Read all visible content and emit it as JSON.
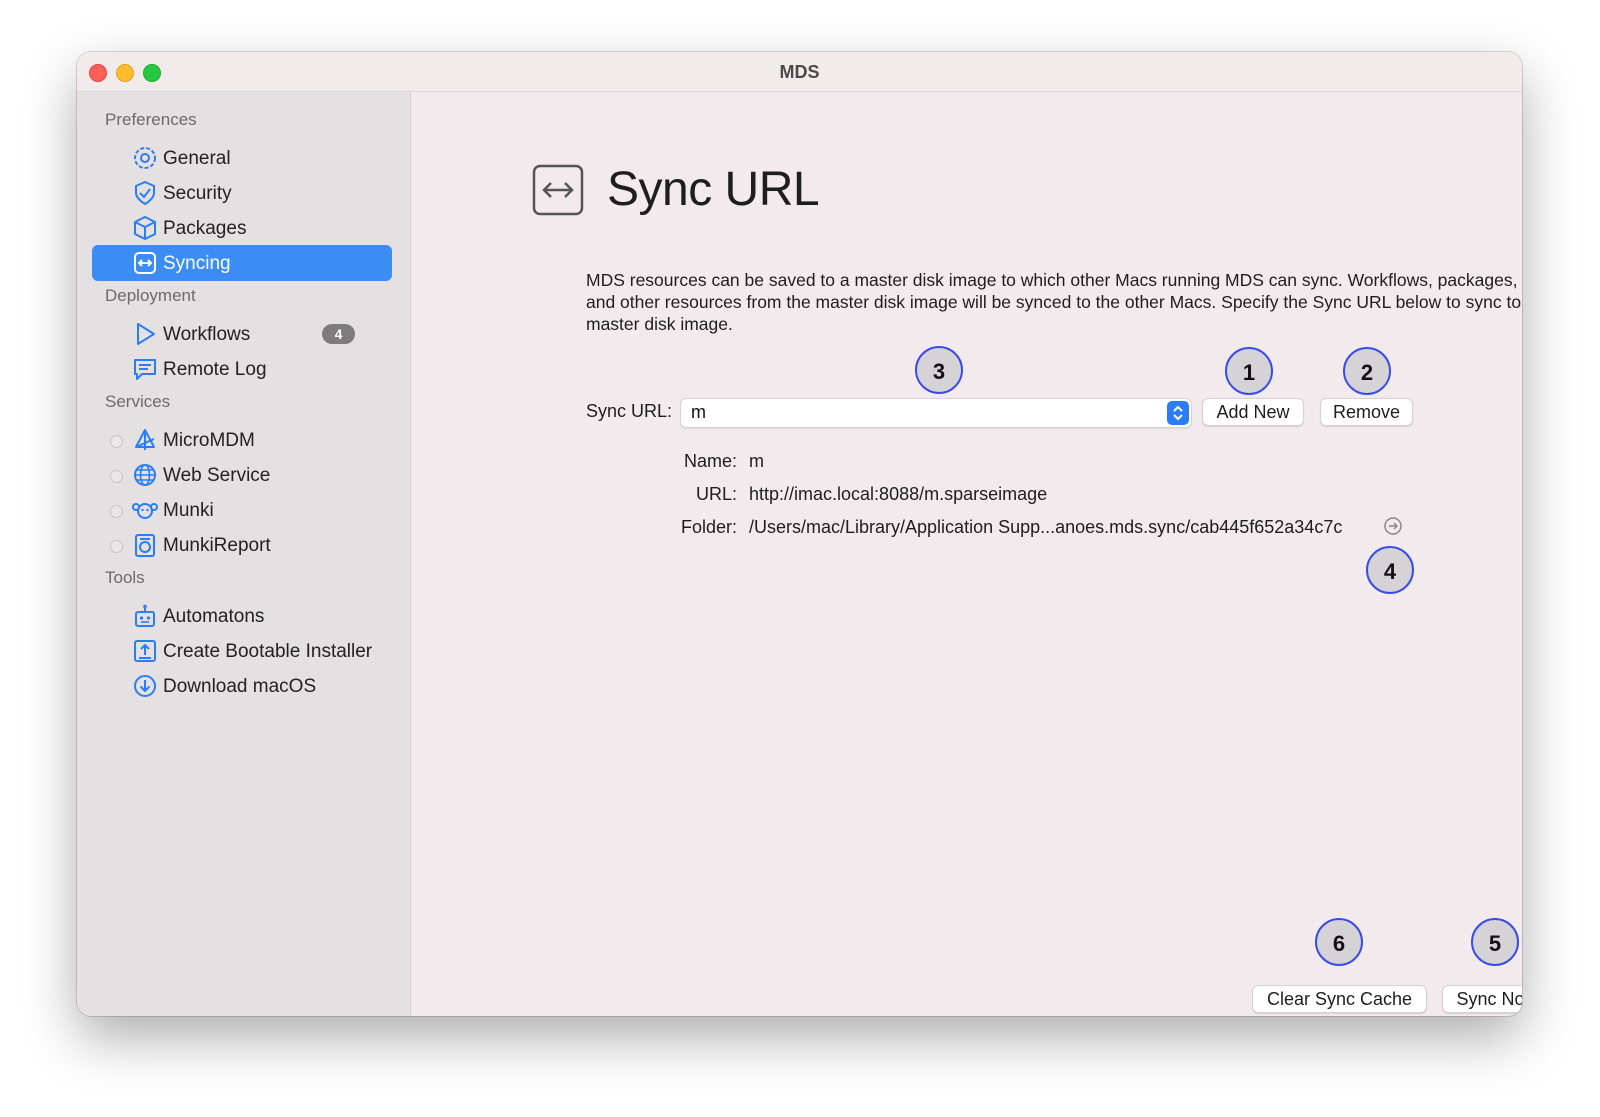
{
  "window": {
    "title": "MDS"
  },
  "sidebar": {
    "sections": [
      {
        "label": "Preferences"
      },
      {
        "label": "Deployment"
      },
      {
        "label": "Services"
      },
      {
        "label": "Tools"
      }
    ],
    "items": [
      {
        "label": "General",
        "icon": "gear-icon"
      },
      {
        "label": "Security",
        "icon": "shield-check-icon"
      },
      {
        "label": "Packages",
        "icon": "package-icon"
      },
      {
        "label": "Syncing",
        "icon": "sync-arrows-icon",
        "selected": true
      },
      {
        "label": "Workflows",
        "icon": "play-icon",
        "badge": "4"
      },
      {
        "label": "Remote Log",
        "icon": "message-log-icon"
      },
      {
        "label": "MicroMDM",
        "icon": "micromdm-icon"
      },
      {
        "label": "Web Service",
        "icon": "globe-icon"
      },
      {
        "label": "Munki",
        "icon": "munki-icon"
      },
      {
        "label": "MunkiReport",
        "icon": "munkireport-icon"
      },
      {
        "label": "Automatons",
        "icon": "robot-icon"
      },
      {
        "label": "Create Bootable Installer",
        "icon": "upload-drive-icon"
      },
      {
        "label": "Download macOS",
        "icon": "download-icon"
      }
    ]
  },
  "main": {
    "title": "Sync URL",
    "description": "MDS resources can be saved to a master disk image to which other Macs running MDS can sync. Workflows, packages, and other resources from the master disk image will be synced to the other Macs. Specify the Sync URL below to sync to a master disk image.",
    "sync_url_label": "Sync URL:",
    "sync_url_value": "m",
    "add_new_label": "Add New",
    "remove_label": "Remove",
    "name_label": "Name:",
    "name_value": "m",
    "url_label": "URL:",
    "url_value": "http://imac.local:8088/m.sparseimage",
    "folder_label": "Folder:",
    "folder_value": "/Users/mac/Library/Application Supp...anoes.mds.sync/cab445f652a34c7c",
    "clear_cache_label": "Clear Sync Cache",
    "sync_now_label": "Sync Now",
    "callouts": [
      "1",
      "2",
      "3",
      "4",
      "5",
      "6"
    ]
  },
  "colors": {
    "accent": "#3b8cf5",
    "callout_border": "#3a4ce6"
  }
}
